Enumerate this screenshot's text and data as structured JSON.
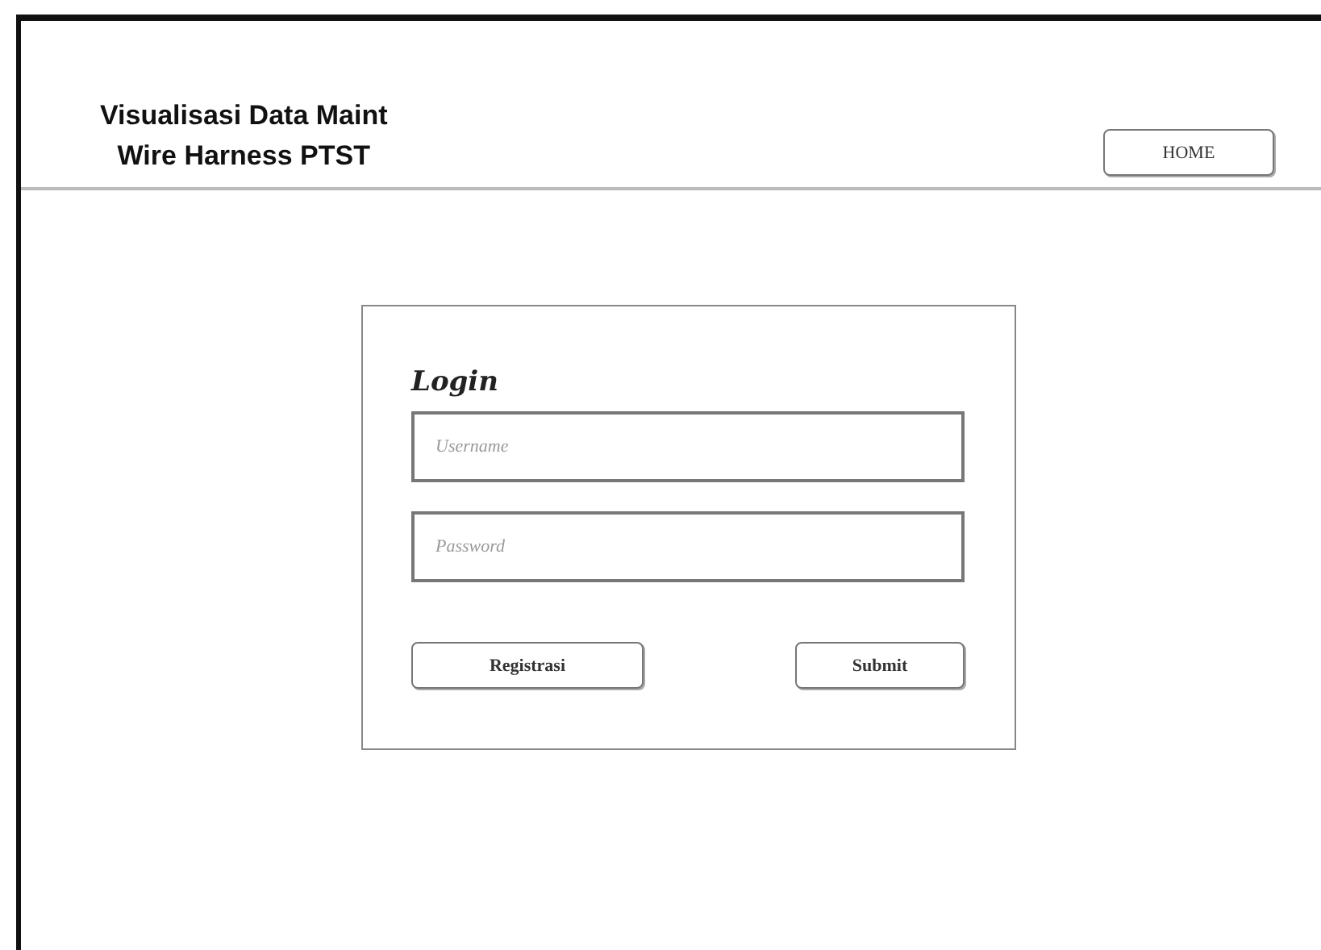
{
  "header": {
    "title_lines": [
      "Visualisasi Data Maint",
      "Wire Harness PTST"
    ],
    "home_button": "HOME"
  },
  "login": {
    "title": "Login",
    "fields": [
      {
        "placeholder": "Username"
      },
      {
        "placeholder": "Password"
      }
    ],
    "buttons": [
      "Registrasi",
      "Submit"
    ]
  }
}
